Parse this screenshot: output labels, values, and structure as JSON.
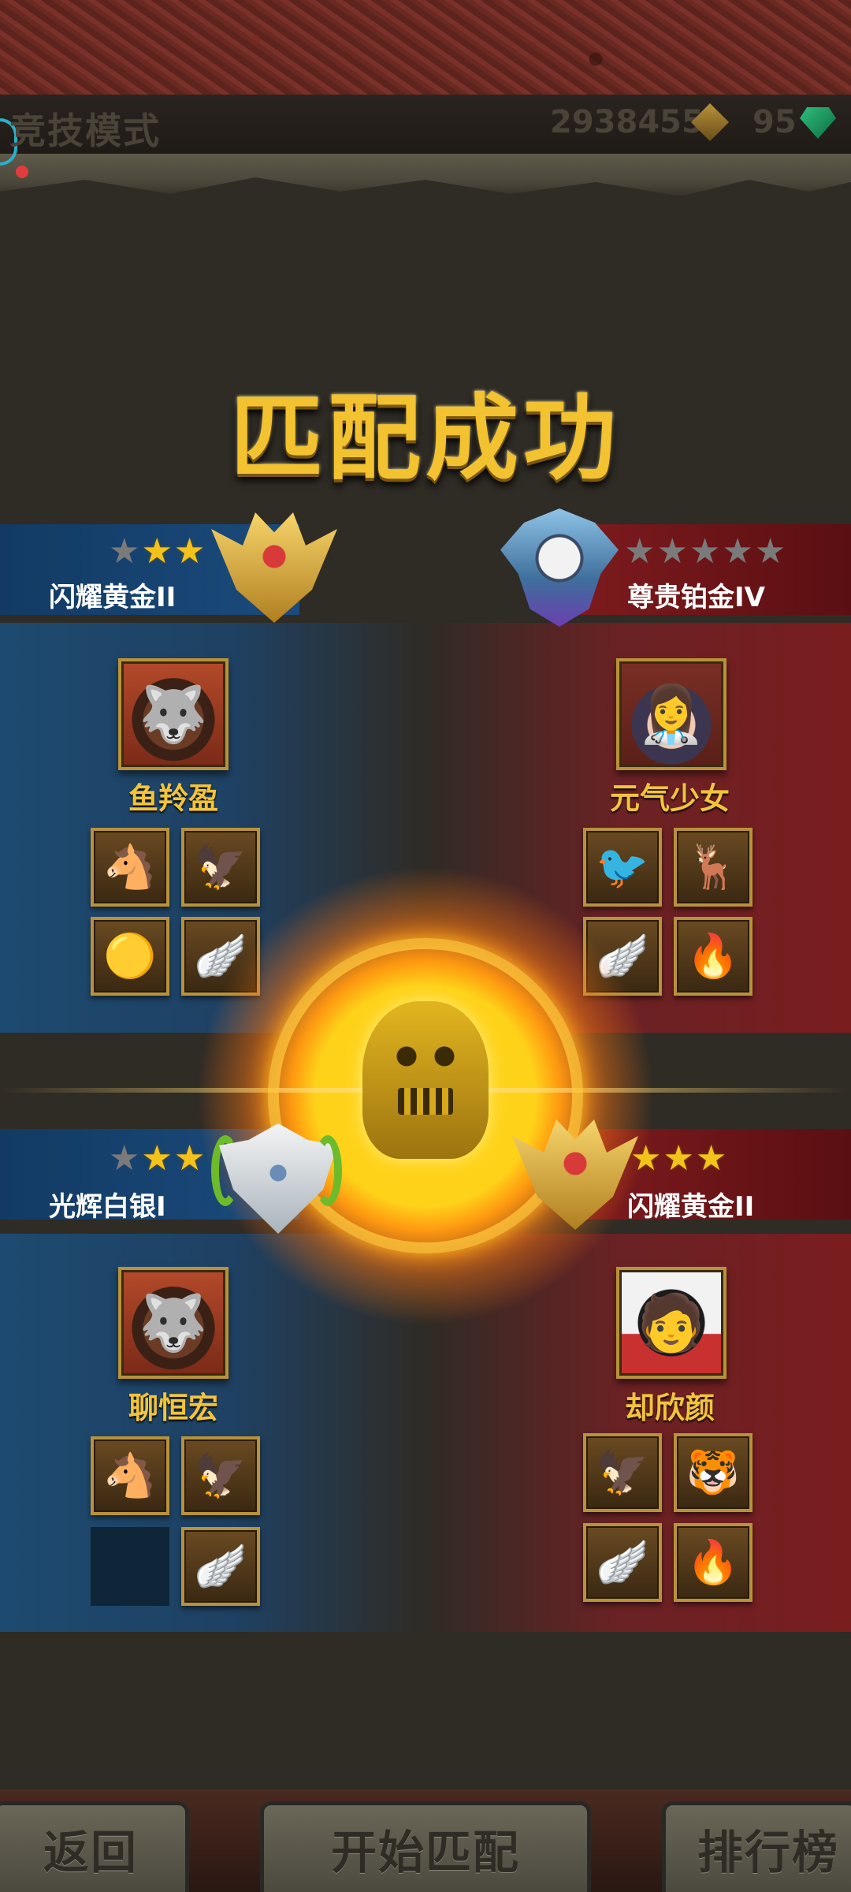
{
  "header": {
    "mode_title": "竞技模式",
    "gold_amount": "2938455",
    "gem_amount": "95"
  },
  "match_title": "匹配成功",
  "teams": [
    {
      "side": "blue",
      "rank": {
        "name": "闪耀黄金II",
        "stars_filled": 2,
        "stars_total": 3
      },
      "player": {
        "name": "鱼羚盈",
        "avatar": "werewolf-avatar"
      },
      "items": [
        "black-horse-icon",
        "eagle-icon",
        "glowing-orb-icon",
        "winged-emblem-icon"
      ]
    },
    {
      "side": "red",
      "rank": {
        "name": "尊贵铂金IV",
        "stars_filled": 0,
        "stars_total": 5
      },
      "player": {
        "name": "元气少女",
        "avatar": "nurse-girl-avatar"
      },
      "items": [
        "bird-icon",
        "stag-icon",
        "winged-emblem-icon",
        "fire-orb-icon"
      ]
    },
    {
      "side": "blue",
      "rank": {
        "name": "光辉白银I",
        "stars_filled": 2,
        "stars_total": 3
      },
      "player": {
        "name": "聊恒宏",
        "avatar": "werewolf-avatar"
      },
      "items": [
        "black-horse-icon",
        "eagle-icon",
        "empty-slot",
        "winged-emblem-icon"
      ]
    },
    {
      "side": "red",
      "rank": {
        "name": "闪耀黄金II",
        "stars_filled": 3,
        "stars_total": 3
      },
      "player": {
        "name": "却欣颜",
        "avatar": "man-headphones-avatar"
      },
      "items": [
        "eagle-icon",
        "white-tiger-icon",
        "winged-emblem-icon",
        "fire-orb-icon"
      ]
    }
  ],
  "bottom_buttons": {
    "back": "返回",
    "start_match": "开始匹配",
    "leaderboard": "排行榜"
  },
  "colors": {
    "blue_team": "#1d4a70",
    "red_team": "#7a1d1f",
    "gold_text": "#f2c43a",
    "star_on": "#f3c31c"
  }
}
